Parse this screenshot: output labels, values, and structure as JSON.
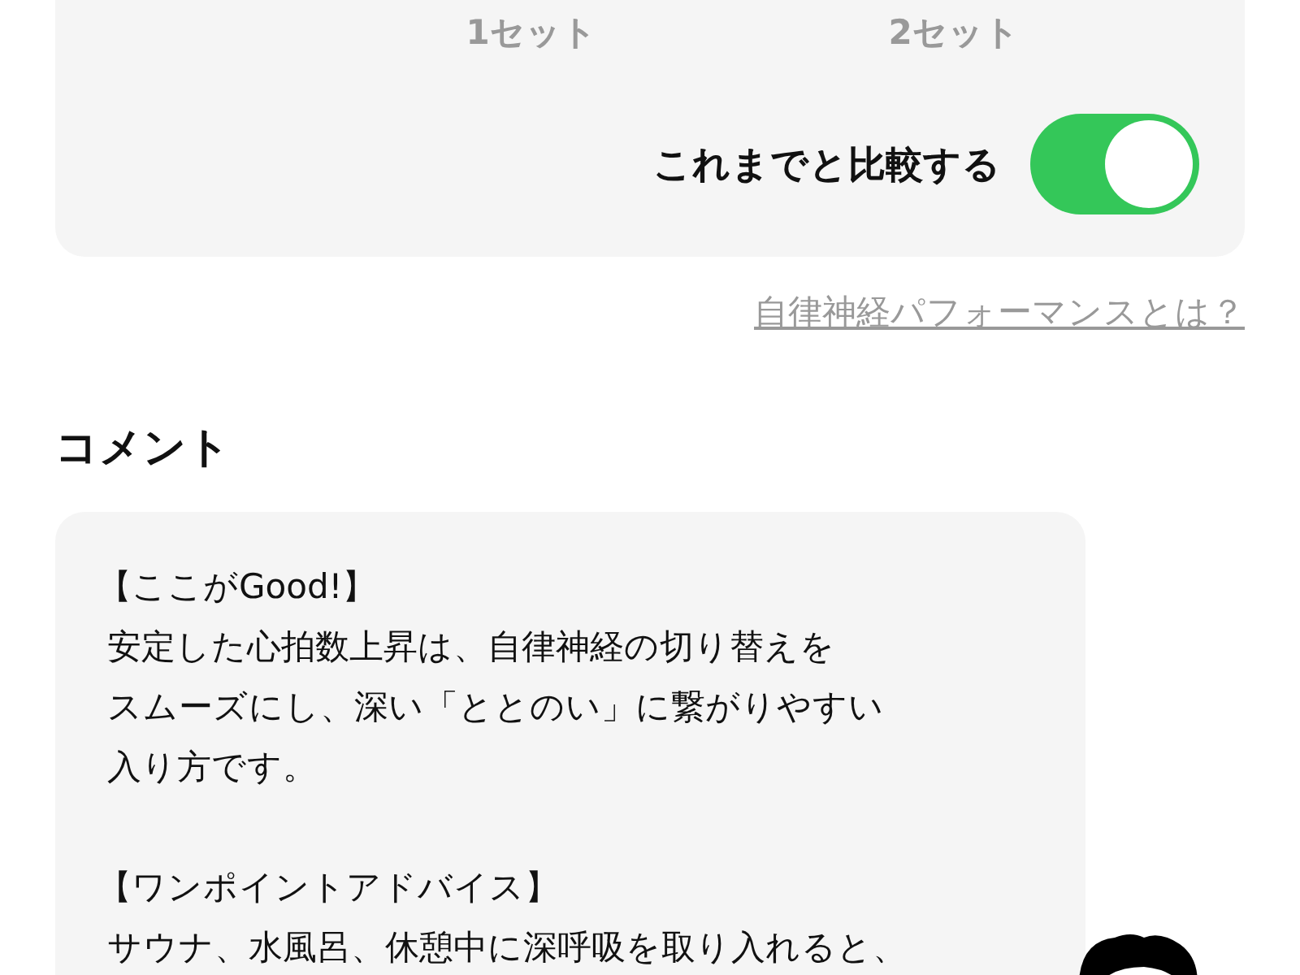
{
  "sets": [
    "1セット",
    "2セット"
  ],
  "compare": {
    "label": "これまでと比較する",
    "on": true
  },
  "help_link": "自律神経パフォーマンスとは？",
  "comment": {
    "title": "コメント",
    "sections": [
      {
        "heading": "【ここがGood!】",
        "lines": [
          "安定した心拍数上昇は、自律神経の切り替えを",
          "スムーズにし、深い「ととのい」に繋がりやすい",
          "入り方です。"
        ]
      },
      {
        "heading": "【ワンポイントアドバイス】",
        "lines": [
          "サウナ、水風呂、休憩中に深呼吸を取り入れると、"
        ]
      }
    ]
  }
}
